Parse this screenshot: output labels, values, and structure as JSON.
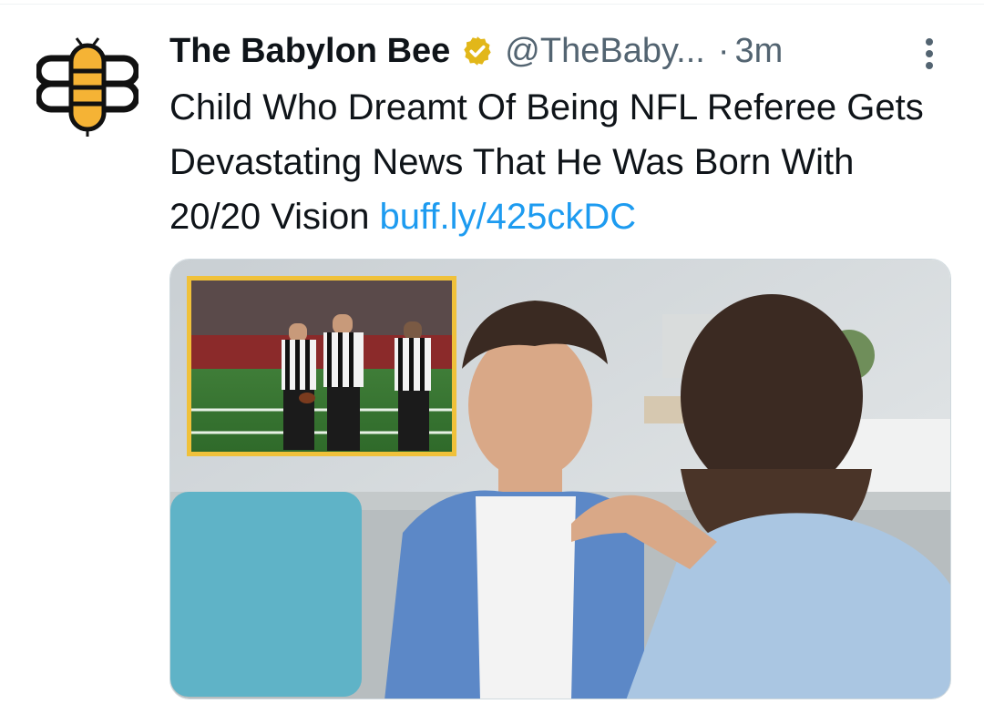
{
  "tweet": {
    "author": {
      "display_name": "The Babylon Bee",
      "handle": "@TheBaby...",
      "verified_icon": "verified-badge-gold",
      "avatar_icon": "bee-logo"
    },
    "separator": "·",
    "time": "3m",
    "text": "Child Who Dreamt Of Being NFL Referee Gets Devastating News That He Was Born With 20/20 Vision ",
    "link": "buff.ly/425ckDC",
    "more_icon": "more-vertical-icon",
    "media": {
      "type": "photo",
      "inset_type": "photo"
    }
  },
  "colors": {
    "link": "#1d9bf0",
    "secondary_text": "#536471",
    "verified_gold": "#e2b719",
    "bee_yellow": "#f5b335"
  }
}
